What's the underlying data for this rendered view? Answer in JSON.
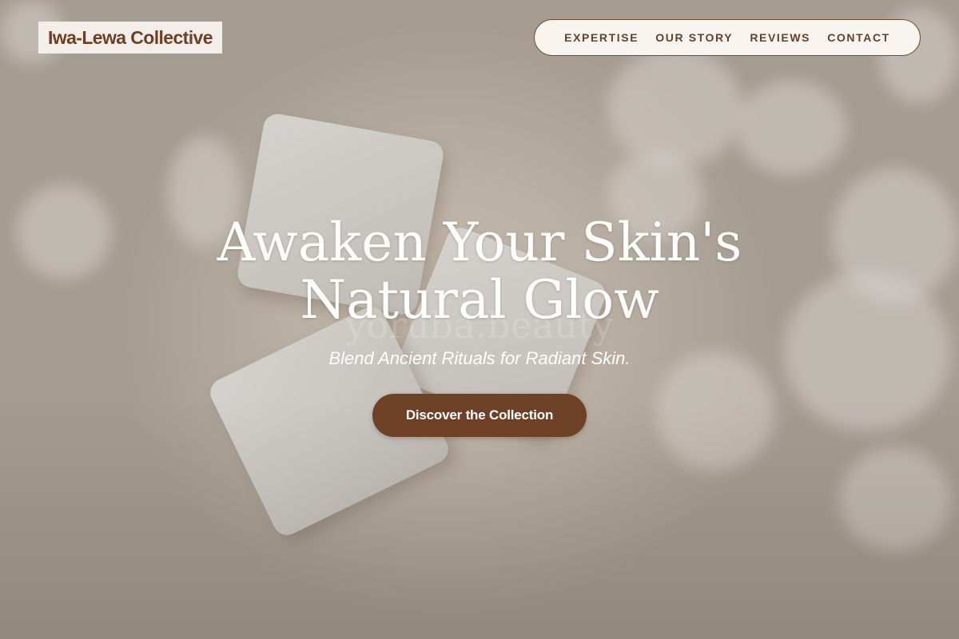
{
  "brand": {
    "name": "Iwa-Lewa Collective"
  },
  "nav": {
    "items": [
      {
        "label": "EXPERTISE"
      },
      {
        "label": "OUR STORY"
      },
      {
        "label": "REVIEWS"
      },
      {
        "label": "CONTACT"
      }
    ]
  },
  "hero": {
    "headline_line1": "Awaken Your Skin's",
    "headline_line2": "Natural Glow",
    "watermark": "yoruba.beauty",
    "tagline": "Blend Ancient Rituals for Radiant Skin.",
    "cta_label": "Discover the Collection",
    "background_image": "white soap bars on beige surface with soft floral shadows"
  },
  "colors": {
    "brand_brown": "#6e4026",
    "nav_text": "#6a3f24",
    "logo_bg": "#f3eee9",
    "nav_bg": "#f8f5f1"
  }
}
